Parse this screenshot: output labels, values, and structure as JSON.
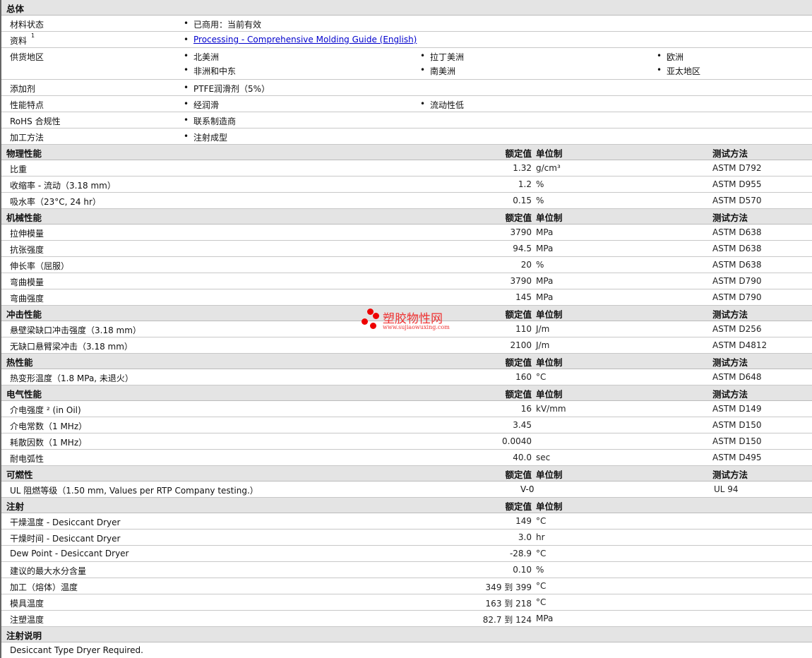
{
  "general": {
    "title": "总体",
    "rows": [
      {
        "label": "材料状态",
        "items": [
          "已商用：当前有效"
        ]
      },
      {
        "label": "资料",
        "sup": "1",
        "link": "Processing - Comprehensive Molding Guide (English)"
      },
      {
        "label": "供货地区",
        "items": [
          "北美洲",
          "拉丁美洲",
          "欧洲",
          "非洲和中东",
          "南美洲",
          "亚太地区"
        ]
      },
      {
        "label": "添加剂",
        "items": [
          "PTFE润滑剂（5%）"
        ]
      },
      {
        "label": "性能特点",
        "items": [
          "经润滑",
          "流动性低"
        ]
      },
      {
        "label": "RoHS 合规性",
        "items": [
          "联系制造商"
        ]
      },
      {
        "label": "加工方法",
        "items": [
          "注射成型"
        ]
      }
    ]
  },
  "headers": {
    "value": "额定值",
    "unit": "单位制",
    "test": "测试方法"
  },
  "sections": [
    {
      "title": "物理性能",
      "rows": [
        [
          "比重",
          "1.32",
          "g/cm³",
          "ASTM D792"
        ],
        [
          "收缩率 - 流动（3.18 mm）",
          "1.2",
          "%",
          "ASTM D955"
        ],
        [
          "吸水率（23°C, 24 hr）",
          "0.15",
          "%",
          "ASTM D570"
        ]
      ]
    },
    {
      "title": "机械性能",
      "rows": [
        [
          "拉伸模量",
          "3790",
          "MPa",
          "ASTM D638"
        ],
        [
          "抗张强度",
          "94.5",
          "MPa",
          "ASTM D638"
        ],
        [
          "伸长率（屈服）",
          "20",
          "%",
          "ASTM D638"
        ],
        [
          "弯曲模量",
          "3790",
          "MPa",
          "ASTM D790"
        ],
        [
          "弯曲强度",
          "145",
          "MPa",
          "ASTM D790"
        ]
      ]
    },
    {
      "title": "冲击性能",
      "rows": [
        [
          "悬壁梁缺口冲击强度（3.18 mm）",
          "110",
          "J/m",
          "ASTM D256"
        ],
        [
          "无缺口悬臂梁冲击（3.18 mm）",
          "2100",
          "J/m",
          "ASTM D4812"
        ]
      ]
    },
    {
      "title": "热性能",
      "rows": [
        [
          "热变形温度（1.8 MPa, 未退火）",
          "160",
          "°C",
          "ASTM D648"
        ]
      ]
    },
    {
      "title": "电气性能",
      "rows": [
        [
          "介电强度 ² (in Oil)",
          "16",
          "kV/mm",
          "ASTM D149"
        ],
        [
          "介电常数（1 MHz）",
          "3.45",
          "",
          "ASTM D150"
        ],
        [
          "耗散因数（1 MHz）",
          "0.0040",
          "",
          "ASTM D150"
        ],
        [
          "耐电弧性",
          "40.0",
          "sec",
          "ASTM D495"
        ]
      ]
    },
    {
      "title": "可燃性",
      "flam": true,
      "rows": [
        [
          "UL 阻燃等级（1.50 mm, Values per RTP Company testing.）",
          "V-0",
          "",
          "UL 94"
        ]
      ]
    },
    {
      "title": "注射",
      "noTest": true,
      "rows": [
        [
          "干燥温度 - Desiccant Dryer",
          "149",
          "°C",
          ""
        ],
        [
          "干燥时间 - Desiccant Dryer",
          "3.0",
          "hr",
          ""
        ],
        [
          "Dew Point - Desiccant Dryer",
          "-28.9",
          "°C",
          ""
        ],
        [
          "建议的最大水分含量",
          "0.10",
          "%",
          ""
        ],
        [
          "加工（熔体）温度",
          "349 到 399",
          "°C",
          ""
        ],
        [
          "模具温度",
          "163 到 218",
          "°C",
          ""
        ],
        [
          "注塑温度",
          "82.7 到 124",
          "MPa",
          ""
        ]
      ]
    },
    {
      "title": "注射说明",
      "note": "Desiccant Type Dryer Required."
    }
  ],
  "watermark": {
    "name": "塑胶物性网",
    "url": "www.sujiaowuxing.com"
  }
}
